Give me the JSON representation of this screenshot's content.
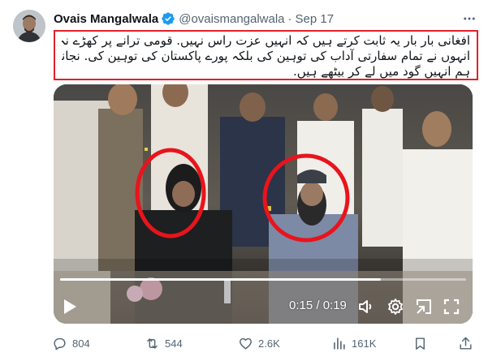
{
  "author": {
    "display_name": "Ovais Mangalwala",
    "handle": "@ovaismangalwala",
    "separator": "·",
    "date": "Sep 17",
    "verified_icon": "verified-badge-icon"
  },
  "tweet": {
    "lines": [
      "افغانی بار بار یہ ثابت کرتے ہیں کہ انہیں عزت راس نہیں. قومی ترانے پر کھڑے نہ ہوکر",
      "انہوں نے تمام سفارتی آداب کی توہین کی بلکہ پورے پاکستان کی توہین کی. نجانے کیوں",
      "ہم انہیں گود میں لے کر بیٹھے ہیں."
    ],
    "highlight_color": "#e0212b"
  },
  "video": {
    "current_time": "0:15",
    "duration": "0:19",
    "timecode": "0:15 / 0:19",
    "progress_fraction": 0.79,
    "annotation_color": "#e8141c"
  },
  "actions": {
    "replies": "804",
    "reposts": "544",
    "likes": "2.6K",
    "views": "161K"
  },
  "colors": {
    "text_primary": "#0f1419",
    "text_secondary": "#536471",
    "verified_blue": "#1d9bf0"
  }
}
